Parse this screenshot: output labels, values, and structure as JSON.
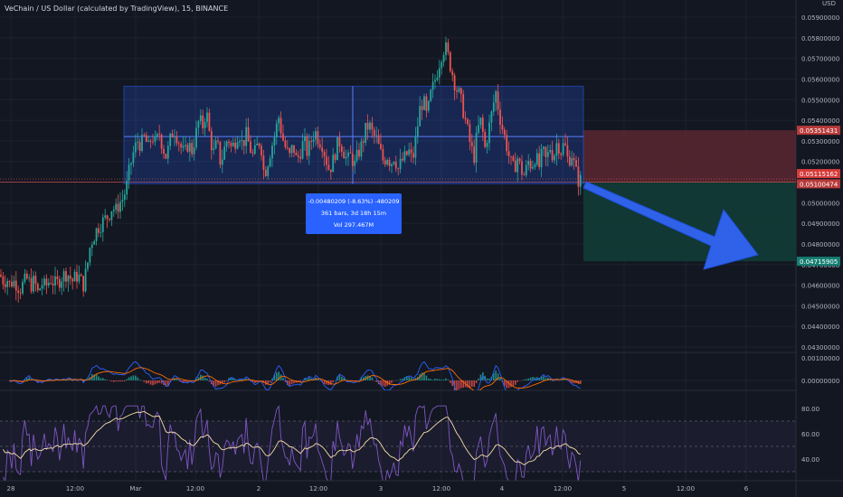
{
  "header": {
    "symbol_title": "VeChain / US Dollar (calculated by TradingView), 15, BINANCE",
    "currency": "USD"
  },
  "colors": {
    "background": "#131722",
    "up": "#26a69a",
    "down": "#ef5350",
    "range_box": "#2962ff",
    "stop_zone": "#5a2730",
    "target_zone": "#123c36",
    "arrow": "#2f62e8",
    "macd_line": "#2962ff",
    "signal_line": "#ff6d00",
    "rsi_line": "#7e57c2",
    "rsi_ma": "#f5dfa6"
  },
  "chart_data": {
    "type": "candlestick",
    "symbol": "VETUSD",
    "interval": "15",
    "exchange": "BINANCE",
    "price_axis": {
      "min": 0.0043,
      "max": 0.0059,
      "ticks": [
        "0.05900000",
        "0.05800000",
        "0.05700000",
        "0.05600000",
        "0.05500000",
        "0.05400000",
        "0.05300000",
        "0.05200000",
        "0.05100000",
        "0.05000000",
        "0.04900000",
        "0.04800000",
        "0.04700000",
        "0.04600000",
        "0.04500000",
        "0.04400000",
        "0.04300000"
      ]
    },
    "time_axis": {
      "ticks": [
        "28",
        "12:00",
        "Mar",
        "12:00",
        "2",
        "12:00",
        "3",
        "12:00",
        "4",
        "12:00",
        "5",
        "12:00",
        "6"
      ]
    },
    "price_labels": [
      {
        "value": "0.05351431",
        "kind": "stop"
      },
      {
        "value": "0.05115162",
        "kind": "last"
      },
      {
        "value": "0.05100474",
        "kind": "entry"
      },
      {
        "value": "0.04715905",
        "kind": "target"
      }
    ],
    "measure": {
      "top": 0.005565,
      "bottom": 0.005092,
      "mid": 0.005321,
      "line1": "-0.00480209 (-8.63%) -480209",
      "line2": "361 bars, 3d 18h 15m",
      "line3": "Vol 297.467M"
    },
    "position": {
      "type": "short",
      "entry": 0.005100474,
      "stop": 0.005351431,
      "target": 0.004715905
    },
    "path": [
      [
        0,
        0.00465
      ],
      [
        4,
        0.00462
      ],
      [
        8,
        0.00463
      ],
      [
        10,
        0.0046
      ],
      [
        14,
        0.00462
      ],
      [
        18,
        0.00461
      ],
      [
        22,
        0.00458
      ],
      [
        26,
        0.00461
      ],
      [
        30,
        0.00463
      ],
      [
        34,
        0.0046
      ],
      [
        38,
        0.00462
      ],
      [
        42,
        0.00456
      ],
      [
        46,
        0.00461
      ],
      [
        50,
        0.00459
      ],
      [
        56,
        0.00463
      ],
      [
        62,
        0.0046
      ],
      [
        68,
        0.00464
      ],
      [
        74,
        0.00466
      ],
      [
        80,
        0.00462
      ],
      [
        86,
        0.00465
      ],
      [
        92,
        0.0046
      ],
      [
        96,
        0.00468
      ],
      [
        100,
        0.0048
      ],
      [
        104,
        0.00484
      ],
      [
        108,
        0.00488
      ],
      [
        112,
        0.0049
      ],
      [
        116,
        0.00492
      ],
      [
        120,
        0.00494
      ],
      [
        124,
        0.00498
      ],
      [
        128,
        0.00496
      ],
      [
        132,
        0.005
      ],
      [
        136,
        0.00502
      ],
      [
        140,
        0.00508
      ],
      [
        144,
        0.00518
      ],
      [
        148,
        0.00525
      ],
      [
        152,
        0.0053
      ],
      [
        156,
        0.00528
      ],
      [
        160,
        0.00532
      ],
      [
        164,
        0.00526
      ],
      [
        168,
        0.00533
      ],
      [
        172,
        0.00528
      ],
      [
        176,
        0.00534
      ],
      [
        180,
        0.00527
      ],
      [
        184,
        0.00522
      ],
      [
        188,
        0.0053
      ],
      [
        192,
        0.00536
      ],
      [
        196,
        0.00532
      ],
      [
        200,
        0.00527
      ],
      [
        204,
        0.00523
      ],
      [
        208,
        0.00529
      ],
      [
        212,
        0.00525
      ],
      [
        216,
        0.00532
      ],
      [
        220,
        0.0054
      ],
      [
        224,
        0.00537
      ],
      [
        228,
        0.00545
      ],
      [
        232,
        0.00532
      ],
      [
        236,
        0.00524
      ],
      [
        240,
        0.00529
      ],
      [
        244,
        0.00519
      ],
      [
        248,
        0.00526
      ],
      [
        252,
        0.00532
      ],
      [
        256,
        0.00526
      ],
      [
        260,
        0.0053
      ],
      [
        264,
        0.00535
      ],
      [
        268,
        0.00528
      ],
      [
        272,
        0.00533
      ],
      [
        276,
        0.00527
      ],
      [
        280,
        0.00522
      ],
      [
        284,
        0.00527
      ],
      [
        288,
        0.00531
      ],
      [
        292,
        0.00513
      ],
      [
        296,
        0.0052
      ],
      [
        300,
        0.00527
      ],
      [
        304,
        0.00533
      ],
      [
        308,
        0.00542
      ],
      [
        312,
        0.00532
      ],
      [
        316,
        0.00526
      ],
      [
        320,
        0.00522
      ],
      [
        324,
        0.00528
      ],
      [
        328,
        0.0052
      ],
      [
        332,
        0.00525
      ],
      [
        336,
        0.0053
      ],
      [
        340,
        0.00524
      ],
      [
        344,
        0.0053
      ],
      [
        348,
        0.00535
      ],
      [
        352,
        0.00531
      ],
      [
        356,
        0.00529
      ],
      [
        360,
        0.00522
      ],
      [
        364,
        0.00516
      ],
      [
        368,
        0.0052
      ],
      [
        372,
        0.00527
      ],
      [
        376,
        0.0053
      ],
      [
        380,
        0.00525
      ],
      [
        384,
        0.0052
      ],
      [
        388,
        0.00523
      ],
      [
        392,
        0.00518
      ],
      [
        396,
        0.00524
      ],
      [
        400,
        0.00528
      ],
      [
        404,
        0.00535
      ],
      [
        408,
        0.00538
      ],
      [
        412,
        0.00533
      ],
      [
        416,
        0.00531
      ],
      [
        420,
        0.00525
      ],
      [
        424,
        0.0052
      ],
      [
        428,
        0.00523
      ],
      [
        432,
        0.00519
      ],
      [
        436,
        0.00523
      ],
      [
        440,
        0.00516
      ],
      [
        444,
        0.0052
      ],
      [
        448,
        0.00522
      ],
      [
        452,
        0.00525
      ],
      [
        456,
        0.0052
      ],
      [
        460,
        0.00532
      ],
      [
        464,
        0.00545
      ],
      [
        468,
        0.0055
      ],
      [
        472,
        0.00541
      ],
      [
        476,
        0.00552
      ],
      [
        480,
        0.00558
      ],
      [
        484,
        0.00565
      ],
      [
        488,
        0.00572
      ],
      [
        492,
        0.00576
      ],
      [
        496,
        0.0057
      ],
      [
        500,
        0.00563
      ],
      [
        504,
        0.00556
      ],
      [
        508,
        0.00552
      ],
      [
        512,
        0.00545
      ],
      [
        516,
        0.00537
      ],
      [
        520,
        0.00528
      ],
      [
        524,
        0.00522
      ],
      [
        528,
        0.00535
      ],
      [
        532,
        0.0054
      ],
      [
        536,
        0.00526
      ],
      [
        540,
        0.00535
      ],
      [
        544,
        0.00544
      ],
      [
        548,
        0.00554
      ],
      [
        552,
        0.00543
      ],
      [
        556,
        0.00535
      ],
      [
        560,
        0.00528
      ],
      [
        564,
        0.0052
      ],
      [
        568,
        0.00516
      ],
      [
        572,
        0.00522
      ],
      [
        576,
        0.00516
      ],
      [
        580,
        0.00513
      ],
      [
        584,
        0.0052
      ],
      [
        588,
        0.00518
      ],
      [
        592,
        0.00523
      ],
      [
        596,
        0.00517
      ],
      [
        600,
        0.00525
      ],
      [
        604,
        0.0052
      ],
      [
        608,
        0.00527
      ],
      [
        612,
        0.00522
      ],
      [
        616,
        0.0053
      ],
      [
        620,
        0.00525
      ],
      [
        624,
        0.00529
      ],
      [
        628,
        0.0052
      ],
      [
        632,
        0.00524
      ],
      [
        636,
        0.00516
      ],
      [
        640,
        0.0051
      ],
      [
        644,
        0.00512
      ]
    ],
    "volume_level_y": 0.005092,
    "macd": {
      "axis_ticks": [
        "0.00100000",
        "0.00000000"
      ]
    },
    "rsi": {
      "axis_ticks": [
        "80.00",
        "60.00",
        "40.00"
      ],
      "levels": [
        70,
        50,
        30
      ]
    }
  }
}
